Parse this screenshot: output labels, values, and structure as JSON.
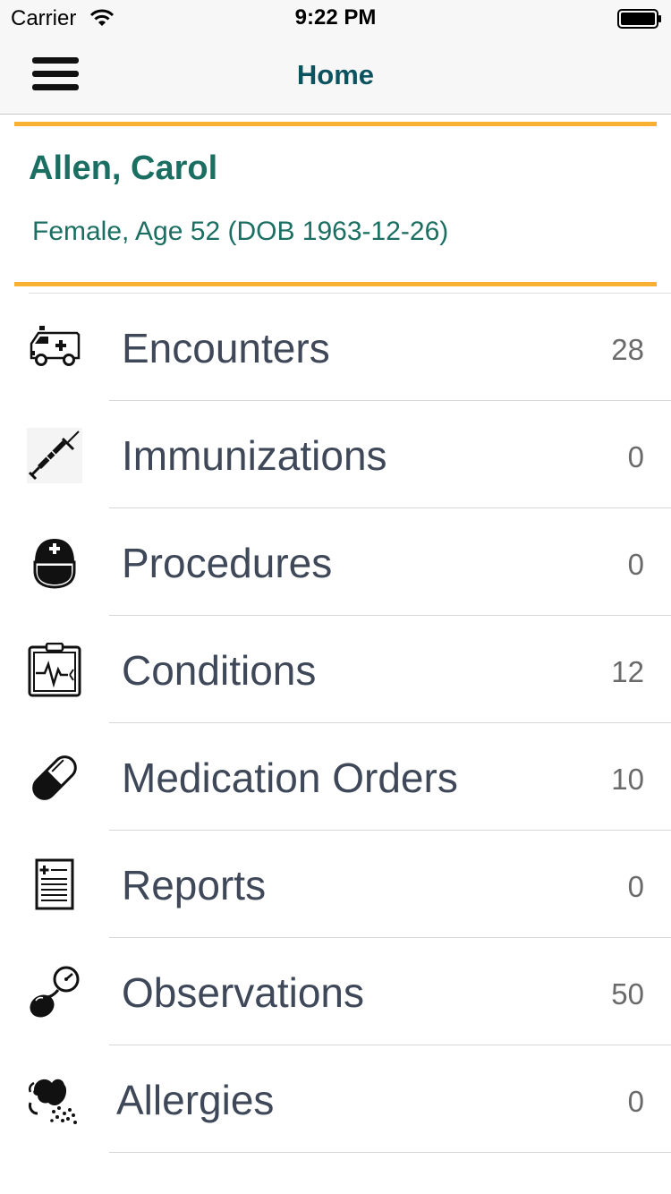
{
  "status_bar": {
    "carrier": "Carrier",
    "time": "9:22 PM"
  },
  "nav": {
    "title": "Home",
    "menu_icon": "hamburger-menu-icon"
  },
  "patient": {
    "name": "Allen, Carol",
    "info": "Female, Age 52 (DOB 1963-12-26)"
  },
  "colors": {
    "accent_orange": "#f8b133",
    "teal": "#1b6f62",
    "nav_title": "#0c5360",
    "label": "#3e4858"
  },
  "menu": [
    {
      "label": "Encounters",
      "count": "28",
      "icon": "ambulance-icon"
    },
    {
      "label": "Immunizations",
      "count": "0",
      "icon": "syringe-icon"
    },
    {
      "label": "Procedures",
      "count": "0",
      "icon": "surgeon-icon"
    },
    {
      "label": "Conditions",
      "count": "12",
      "icon": "clipboard-heartbeat-icon"
    },
    {
      "label": "Medication Orders",
      "count": "10",
      "icon": "pill-capsule-icon"
    },
    {
      "label": "Reports",
      "count": "0",
      "icon": "medical-report-icon"
    },
    {
      "label": "Observations",
      "count": "50",
      "icon": "blood-pressure-gauge-icon"
    },
    {
      "label": "Allergies",
      "count": "0",
      "icon": "allergy-icon"
    }
  ]
}
